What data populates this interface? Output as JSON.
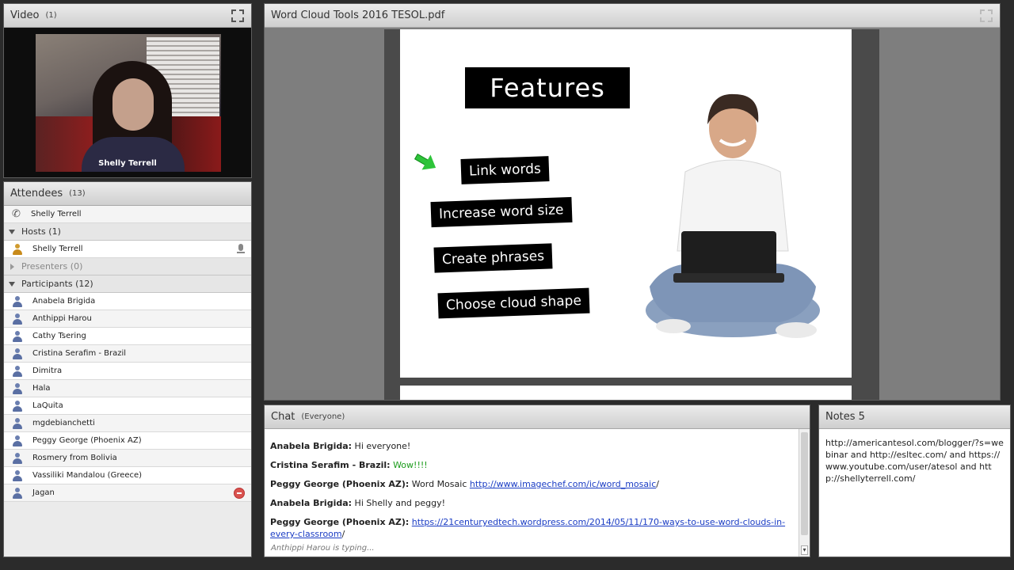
{
  "video": {
    "title": "Video",
    "count": "(1)",
    "presenter_name": "Shelly Terrell"
  },
  "attendees": {
    "title": "Attendees",
    "count": "(13)",
    "phone_user": "Shelly Terrell",
    "hosts_label": "Hosts (1)",
    "hosts": [
      "Shelly Terrell"
    ],
    "presenters_label": "Presenters (0)",
    "participants_label": "Participants (12)",
    "participants": [
      "Anabela Brigida",
      "Anthippi Harou",
      "Cathy Tsering",
      "Cristina Serafim - Brazil",
      "Dimitra",
      "Hala",
      "LaQuita",
      "mgdebianchetti",
      "Peggy George (Phoenix AZ)",
      "Rosmery from Bolivia",
      "Vassiliki Mandalou (Greece)",
      "Jagan"
    ]
  },
  "share": {
    "title": "Word Cloud Tools 2016 TESOL.pdf",
    "slide": {
      "heading": "Features",
      "items": [
        "Link words",
        "Increase word size",
        "Create phrases",
        "Choose  cloud shape"
      ]
    }
  },
  "chat": {
    "title": "Chat",
    "scope": "(Everyone)",
    "messages": [
      {
        "who": "Anabela Brigida:",
        "text": "Hi everyone!"
      },
      {
        "who": "Cristina Serafim - Brazil:",
        "text": "Wow!!!!"
      },
      {
        "who": "Peggy George (Phoenix AZ):",
        "text": "Word Mosaic",
        "link": "http://www.imagechef.com/ic/word_mosaic",
        "after": "/"
      },
      {
        "who": "Anabela Brigida:",
        "text": "Hi Shelly and peggy!"
      },
      {
        "who": "Peggy George (Phoenix AZ):",
        "link": "https://21centuryedtech.wordpress.com/2014/05/11/170-ways-to-use-word-clouds-in-every-classroom",
        "after": "/"
      }
    ],
    "typing": "Anthippi Harou is typing..."
  },
  "notes": {
    "title": "Notes 5",
    "text": "http://americantesol.com/blogger/?s=webinar and http://esltec.com/ and https://www.youtube.com/user/atesol and http://shellyterrell.com/"
  },
  "colors": {
    "accent_link": "#1a3cc4",
    "chat_green": "#1a9b1a",
    "arrow": "#2ec43a"
  }
}
